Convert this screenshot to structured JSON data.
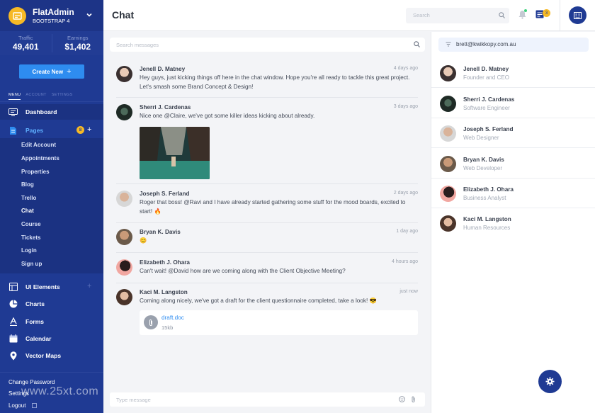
{
  "brand": {
    "name": "FlatAdmin",
    "sub": "BOOTSTRAP 4",
    "logo_color": "#f6b925"
  },
  "stats": [
    {
      "label": "Traffic",
      "value": "49,401"
    },
    {
      "label": "Earnings",
      "value": "$1,402"
    }
  ],
  "sidebar": {
    "create_label": "Create New",
    "tabs": [
      "MENU",
      "ACCOUNT",
      "SETTINGS"
    ],
    "nav": {
      "dashboard": "Dashboard",
      "pages": "Pages",
      "pages_badge": "8",
      "ui_elements": "UI Elements",
      "charts": "Charts",
      "forms": "Forms",
      "calendar": "Calendar",
      "vector_maps": "Vector Maps"
    },
    "subitems": [
      "Edit Account",
      "Appointments",
      "Properties",
      "Blog",
      "Trello",
      "Chat",
      "Course",
      "Tickets",
      "Login",
      "Sign up"
    ],
    "bottom": [
      "Change Password",
      "Settings",
      "Logout"
    ]
  },
  "header": {
    "title": "Chat",
    "search_placeholder": "Search",
    "inbox_badge": "3"
  },
  "chat": {
    "search_placeholder": "Search messages",
    "composer_placeholder": "Type message",
    "messages": [
      {
        "name": "Jenell D. Matney",
        "time": "4 days ago",
        "text": "Hey guys, just kicking things off here in the chat window. Hope you're all ready to tackle this great project. Let's smash some Brand Concept & Design!"
      },
      {
        "name": "Sherri J. Cardenas",
        "time": "3 days ago",
        "text": "Nice one @Claire, we've got some killer ideas kicking about already."
      },
      {
        "name": "Joseph S. Ferland",
        "time": "2 days ago",
        "text": "Roger that boss! @Ravi and I have already started gathering some stuff for the mood boards, excited to start! 🔥"
      },
      {
        "name": "Bryan K. Davis",
        "time": "1 day ago",
        "text": "😊"
      },
      {
        "name": "Elizabeth J. Ohara",
        "time": "4 hours ago",
        "text": "Can't wait! @David how are we coming along with the Client Objective Meeting?"
      },
      {
        "name": "Kaci M. Langston",
        "time": "just now",
        "text": "Coming along nicely, we've got a draft for the client questionnaire completed, take a look! 😎"
      }
    ],
    "attachment": {
      "name": "draft.doc",
      "size": "15kb"
    }
  },
  "contacts": {
    "filter_value": "brett@kwikkopy.com.au",
    "list": [
      {
        "name": "Jenell D. Matney",
        "role": "Founder and CEO"
      },
      {
        "name": "Sherri J. Cardenas",
        "role": "Software Engineer"
      },
      {
        "name": "Joseph S. Ferland",
        "role": "Web Designer"
      },
      {
        "name": "Bryan K. Davis",
        "role": "Web Developer"
      },
      {
        "name": "Elizabeth J. Ohara",
        "role": "Business Analyst"
      },
      {
        "name": "Kaci M. Langston",
        "role": "Human Resources"
      }
    ]
  },
  "watermark": "www.25xt.com",
  "colors": {
    "sidebar": "#1f3a93",
    "accent": "#2e8cf0",
    "badge": "#f6b925"
  }
}
